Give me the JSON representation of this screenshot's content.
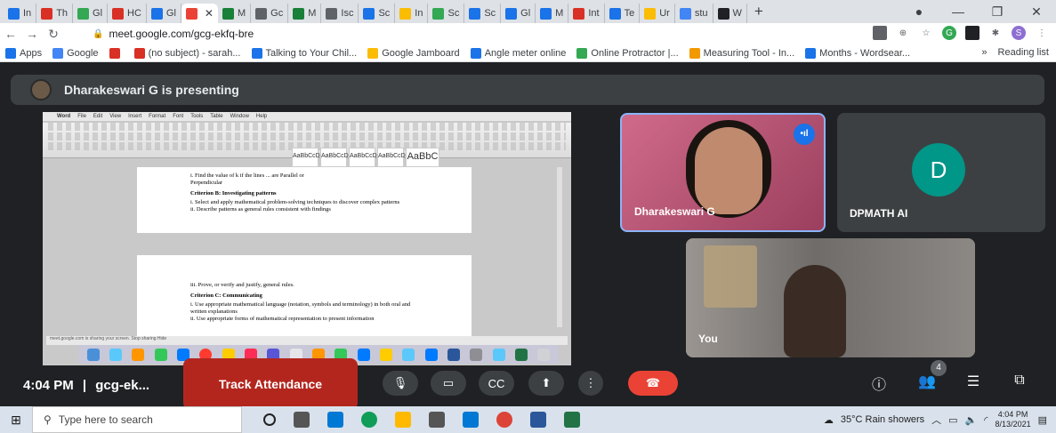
{
  "browser": {
    "tabs": [
      {
        "label": "In",
        "color": "#1a73e8"
      },
      {
        "label": "Th",
        "color": "#d93025"
      },
      {
        "label": "Gl",
        "color": "#34a853"
      },
      {
        "label": "HC",
        "color": "#d93025"
      },
      {
        "label": "Gl",
        "color": "#1a73e8"
      },
      {
        "label": "",
        "color": "#ea4335",
        "active": true
      },
      {
        "label": "M",
        "color": "#188038"
      },
      {
        "label": "Gc",
        "color": "#5f6368"
      },
      {
        "label": "M",
        "color": "#188038"
      },
      {
        "label": "Isc",
        "color": "#5f6368"
      },
      {
        "label": "Sc",
        "color": "#1a73e8"
      },
      {
        "label": "In",
        "color": "#fbbc04"
      },
      {
        "label": "Sc",
        "color": "#34a853"
      },
      {
        "label": "Sc",
        "color": "#1a73e8"
      },
      {
        "label": "Gl",
        "color": "#1a73e8"
      },
      {
        "label": "M",
        "color": "#1a73e8"
      },
      {
        "label": "Int",
        "color": "#d93025"
      },
      {
        "label": "Te",
        "color": "#1a73e8"
      },
      {
        "label": "Ur",
        "color": "#fbbc04"
      },
      {
        "label": "stu",
        "color": "#4285f4"
      },
      {
        "label": "W",
        "color": "#202124"
      }
    ],
    "new_tab": "+",
    "url": "meet.google.com/gcg-ekfq-bre",
    "bookmarks": [
      {
        "label": "Apps",
        "color": "#1a73e8"
      },
      {
        "label": "Google",
        "color": "#4285f4"
      },
      {
        "label": "",
        "color": "#d93025"
      },
      {
        "label": "(no subject) - sarah...",
        "color": "#d93025"
      },
      {
        "label": "Talking to Your Chil...",
        "color": "#1a73e8"
      },
      {
        "label": "Google Jamboard",
        "color": "#fbbc04"
      },
      {
        "label": "Angle meter online",
        "color": "#1a73e8"
      },
      {
        "label": "Online Protractor |...",
        "color": "#34a853"
      },
      {
        "label": "Measuring Tool - In...",
        "color": "#f29900"
      },
      {
        "label": "Months - Wordsear...",
        "color": "#1a73e8"
      }
    ],
    "bookmarks_more": "»",
    "reading_list": "Reading list",
    "profile_initial": "S"
  },
  "meet": {
    "presenting_text": "Dharakeswari G is presenting",
    "shared_doc": {
      "menu": [
        "Word",
        "File",
        "Edit",
        "View",
        "Insert",
        "Format",
        "Font",
        "Tools",
        "Table",
        "Window",
        "Help"
      ],
      "styles": [
        "AaBbCcDdEe",
        "AaBbCcDdEe",
        "AaBbCcDc",
        "AaBbCcDdEe",
        "AaBbC"
      ],
      "page1_lines": [
        "i. Find the value of k if the lines ... are Parallel or",
        "Perpendicular"
      ],
      "page1_heading": "Criterion B: Investigating patterns",
      "page1_items": [
        "i. Select and apply mathematical problem-solving techniques to discover complex patterns",
        "ii. Describe patterns as general rules consistent with findings"
      ],
      "page2_line": "iii. Prove, or verify and justify, general rules.",
      "page2_heading": "Criterion C: Communicating",
      "page2_items": [
        "i. Use appropriate mathematical language (notation, symbols and terminology) in both oral and written explanations",
        "ii. Use appropriate forms of mathematical representation to present information"
      ],
      "sharing_bar": "meet.google.com is sharing your screen.   Stop sharing   Hide"
    },
    "participants": [
      {
        "name": "Dharakeswari G",
        "speaking": true
      },
      {
        "name": "DPMATH AI",
        "avatar_initial": "D",
        "avatar_color": "#009688"
      },
      {
        "name": "You"
      }
    ],
    "bottom_bar": {
      "time": "4:04 PM",
      "separator": "|",
      "meeting_code": "gcg-ek...",
      "track_attendance": "Track Attendance",
      "people_count": "4"
    }
  },
  "taskbar": {
    "search_placeholder": "Type here to search",
    "weather": "35°C  Rain showers",
    "time": "4:04 PM",
    "date": "8/13/2021"
  }
}
